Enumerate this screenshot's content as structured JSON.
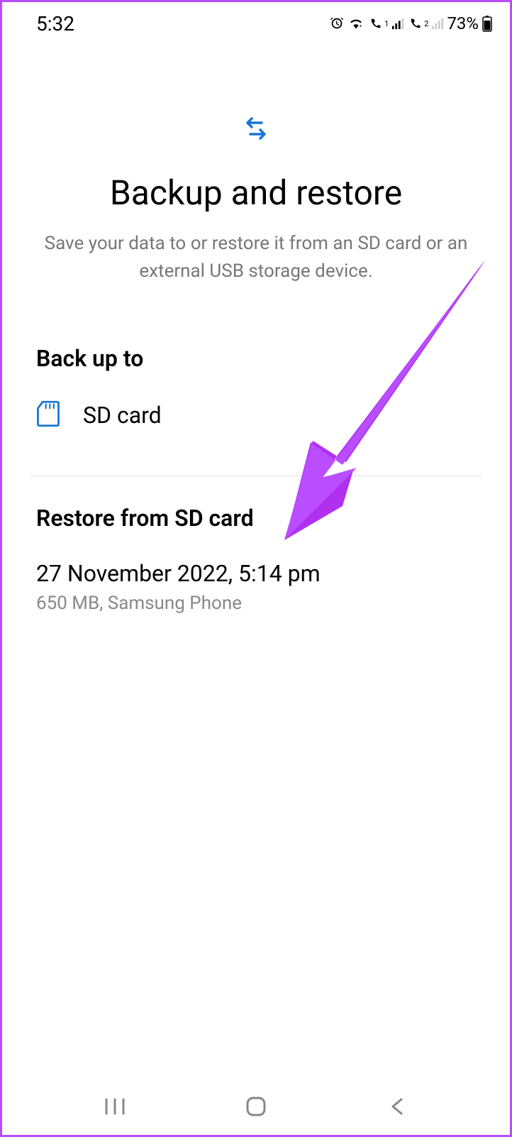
{
  "statusBar": {
    "time": "5:32",
    "battery": "73%"
  },
  "header": {
    "title": "Backup and restore",
    "subtitle": "Save your data to or restore it from an SD card or an external USB storage device."
  },
  "backup": {
    "sectionTitle": "Back up to",
    "option": "SD card"
  },
  "restore": {
    "sectionTitle": "Restore from SD card",
    "item": {
      "date": "27 November 2022, 5:14 pm",
      "meta": "650 MB, Samsung Phone"
    }
  }
}
